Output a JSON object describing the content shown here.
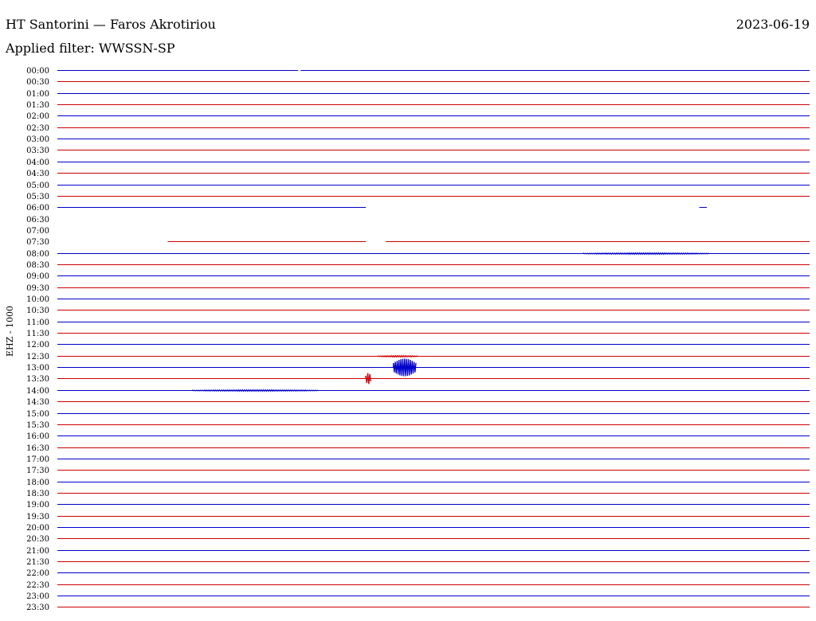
{
  "header": {
    "station": "HT Santorini — Faros Akrotiriou",
    "date": "2023-06-19",
    "filter": "Applied filter: WWSSN-SP"
  },
  "chart_data": {
    "type": "line",
    "title": "HT Santorini — Faros Akrotiriou",
    "ylabel": "EHZ - 1000",
    "x_range_minutes": [
      0,
      30
    ],
    "grid": false,
    "colors": {
      "even": "#0000cc",
      "odd": "#cc0000"
    },
    "rows": [
      "00:00",
      "00:30",
      "01:00",
      "01:30",
      "02:00",
      "02:30",
      "03:00",
      "03:30",
      "04:00",
      "04:30",
      "05:00",
      "05:30",
      "06:00",
      "06:30",
      "07:00",
      "07:30",
      "08:00",
      "08:30",
      "09:00",
      "09:30",
      "10:00",
      "10:30",
      "11:00",
      "11:30",
      "12:00",
      "12:30",
      "13:00",
      "13:30",
      "14:00",
      "14:30",
      "15:00",
      "15:30",
      "16:00",
      "16:30",
      "17:00",
      "17:30",
      "18:00",
      "18:30",
      "19:00",
      "19:30",
      "20:00",
      "20:30",
      "21:00",
      "21:30",
      "22:00",
      "22:30",
      "23:00",
      "23:30"
    ],
    "data_gaps": [
      {
        "row": "00:00",
        "from_min": 9.6,
        "to_min": 9.7
      },
      {
        "row": "06:00",
        "from_min": 12.3,
        "to_min": 25.6
      },
      {
        "row": "06:00",
        "from_min": 25.9,
        "to_min": 30
      },
      {
        "row": "06:30",
        "from_min": 0,
        "to_min": 30
      },
      {
        "row": "07:00",
        "from_min": 0,
        "to_min": 30
      },
      {
        "row": "07:30",
        "from_min": 0,
        "to_min": 4.4
      },
      {
        "row": "07:30",
        "from_min": 12.3,
        "to_min": 13.1
      }
    ],
    "events": [
      {
        "row": "13:00",
        "at_min": 13.4,
        "amplitude": 11,
        "width_min": 0.9
      },
      {
        "row": "13:30",
        "at_min": 12.3,
        "amplitude": 7,
        "width_min": 0.2
      },
      {
        "row": "14:00",
        "at_min": 5.4,
        "amplitude": 1,
        "width_min": 5.0
      },
      {
        "row": "08:00",
        "at_min": 21.0,
        "amplitude": 1,
        "width_min": 5.0
      },
      {
        "row": "12:30",
        "at_min": 12.8,
        "amplitude": 1,
        "width_min": 1.6
      }
    ]
  }
}
